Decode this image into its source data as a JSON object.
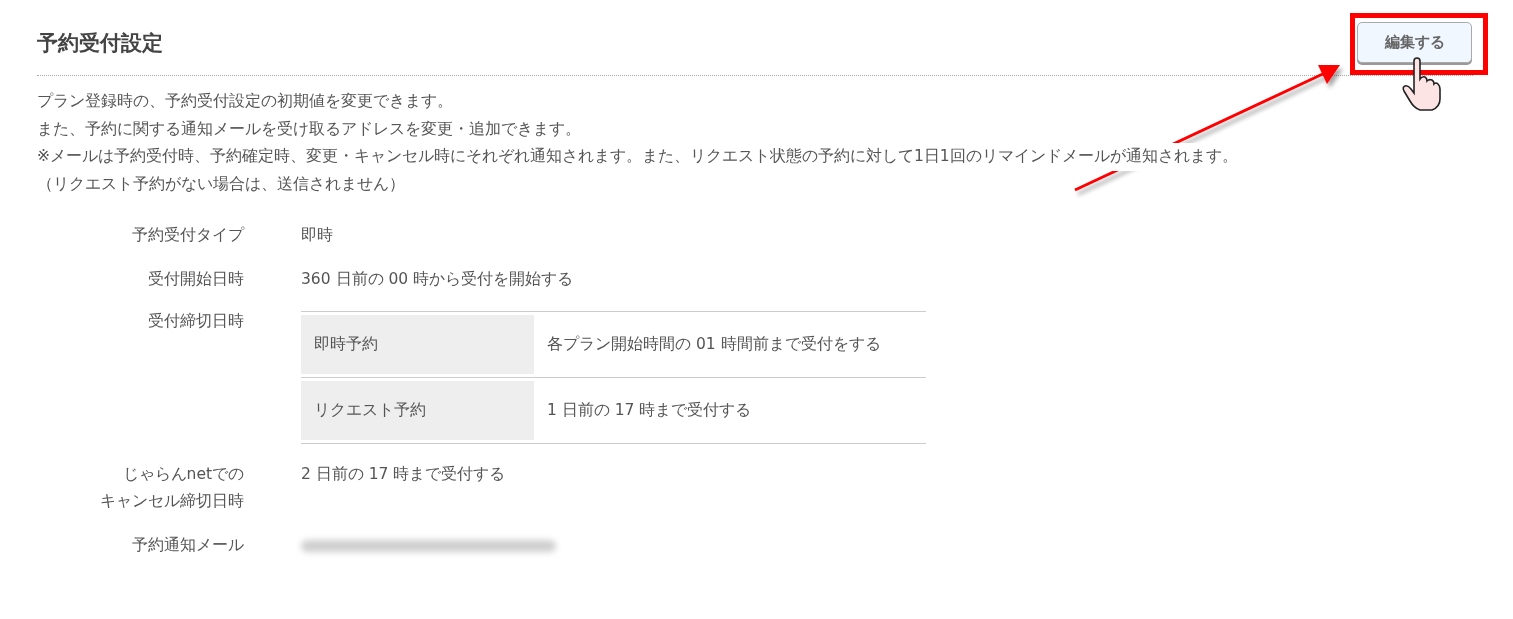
{
  "section": {
    "title": "予約受付設定",
    "edit_button": "編集する"
  },
  "description": [
    "プラン登録時の、予約受付設定の初期値を変更できます。",
    "また、予約に関する通知メールを受け取るアドレスを変更・追加できます。",
    "※メールは予約受付時、予約確定時、変更・キャンセル時にそれぞれ通知されます。また、リクエスト状態の予約に対して1日1回のリマインドメールが通知されます。",
    "（リクエスト予約がない場合は、送信されません）"
  ],
  "settings": [
    {
      "kind": "text",
      "label": [
        "予約受付タイプ"
      ],
      "value": "即時"
    },
    {
      "kind": "text",
      "label": [
        "受付開始日時"
      ],
      "value": "360 日前の 00 時から受付を開始する"
    },
    {
      "kind": "table",
      "label": [
        "受付締切日時"
      ],
      "rows": [
        {
          "name": "即時予約",
          "value": "各プラン開始時間の 01 時間前まで受付をする"
        },
        {
          "name": "リクエスト予約",
          "value": "1 日前の 17 時まで受付する"
        }
      ]
    },
    {
      "kind": "text",
      "label": [
        "じゃらんnetでの",
        "キャンセル締切日時"
      ],
      "value": "2 日前の 17 時まで受付する"
    },
    {
      "kind": "hidden",
      "label": [
        "予約通知メール"
      ]
    }
  ]
}
